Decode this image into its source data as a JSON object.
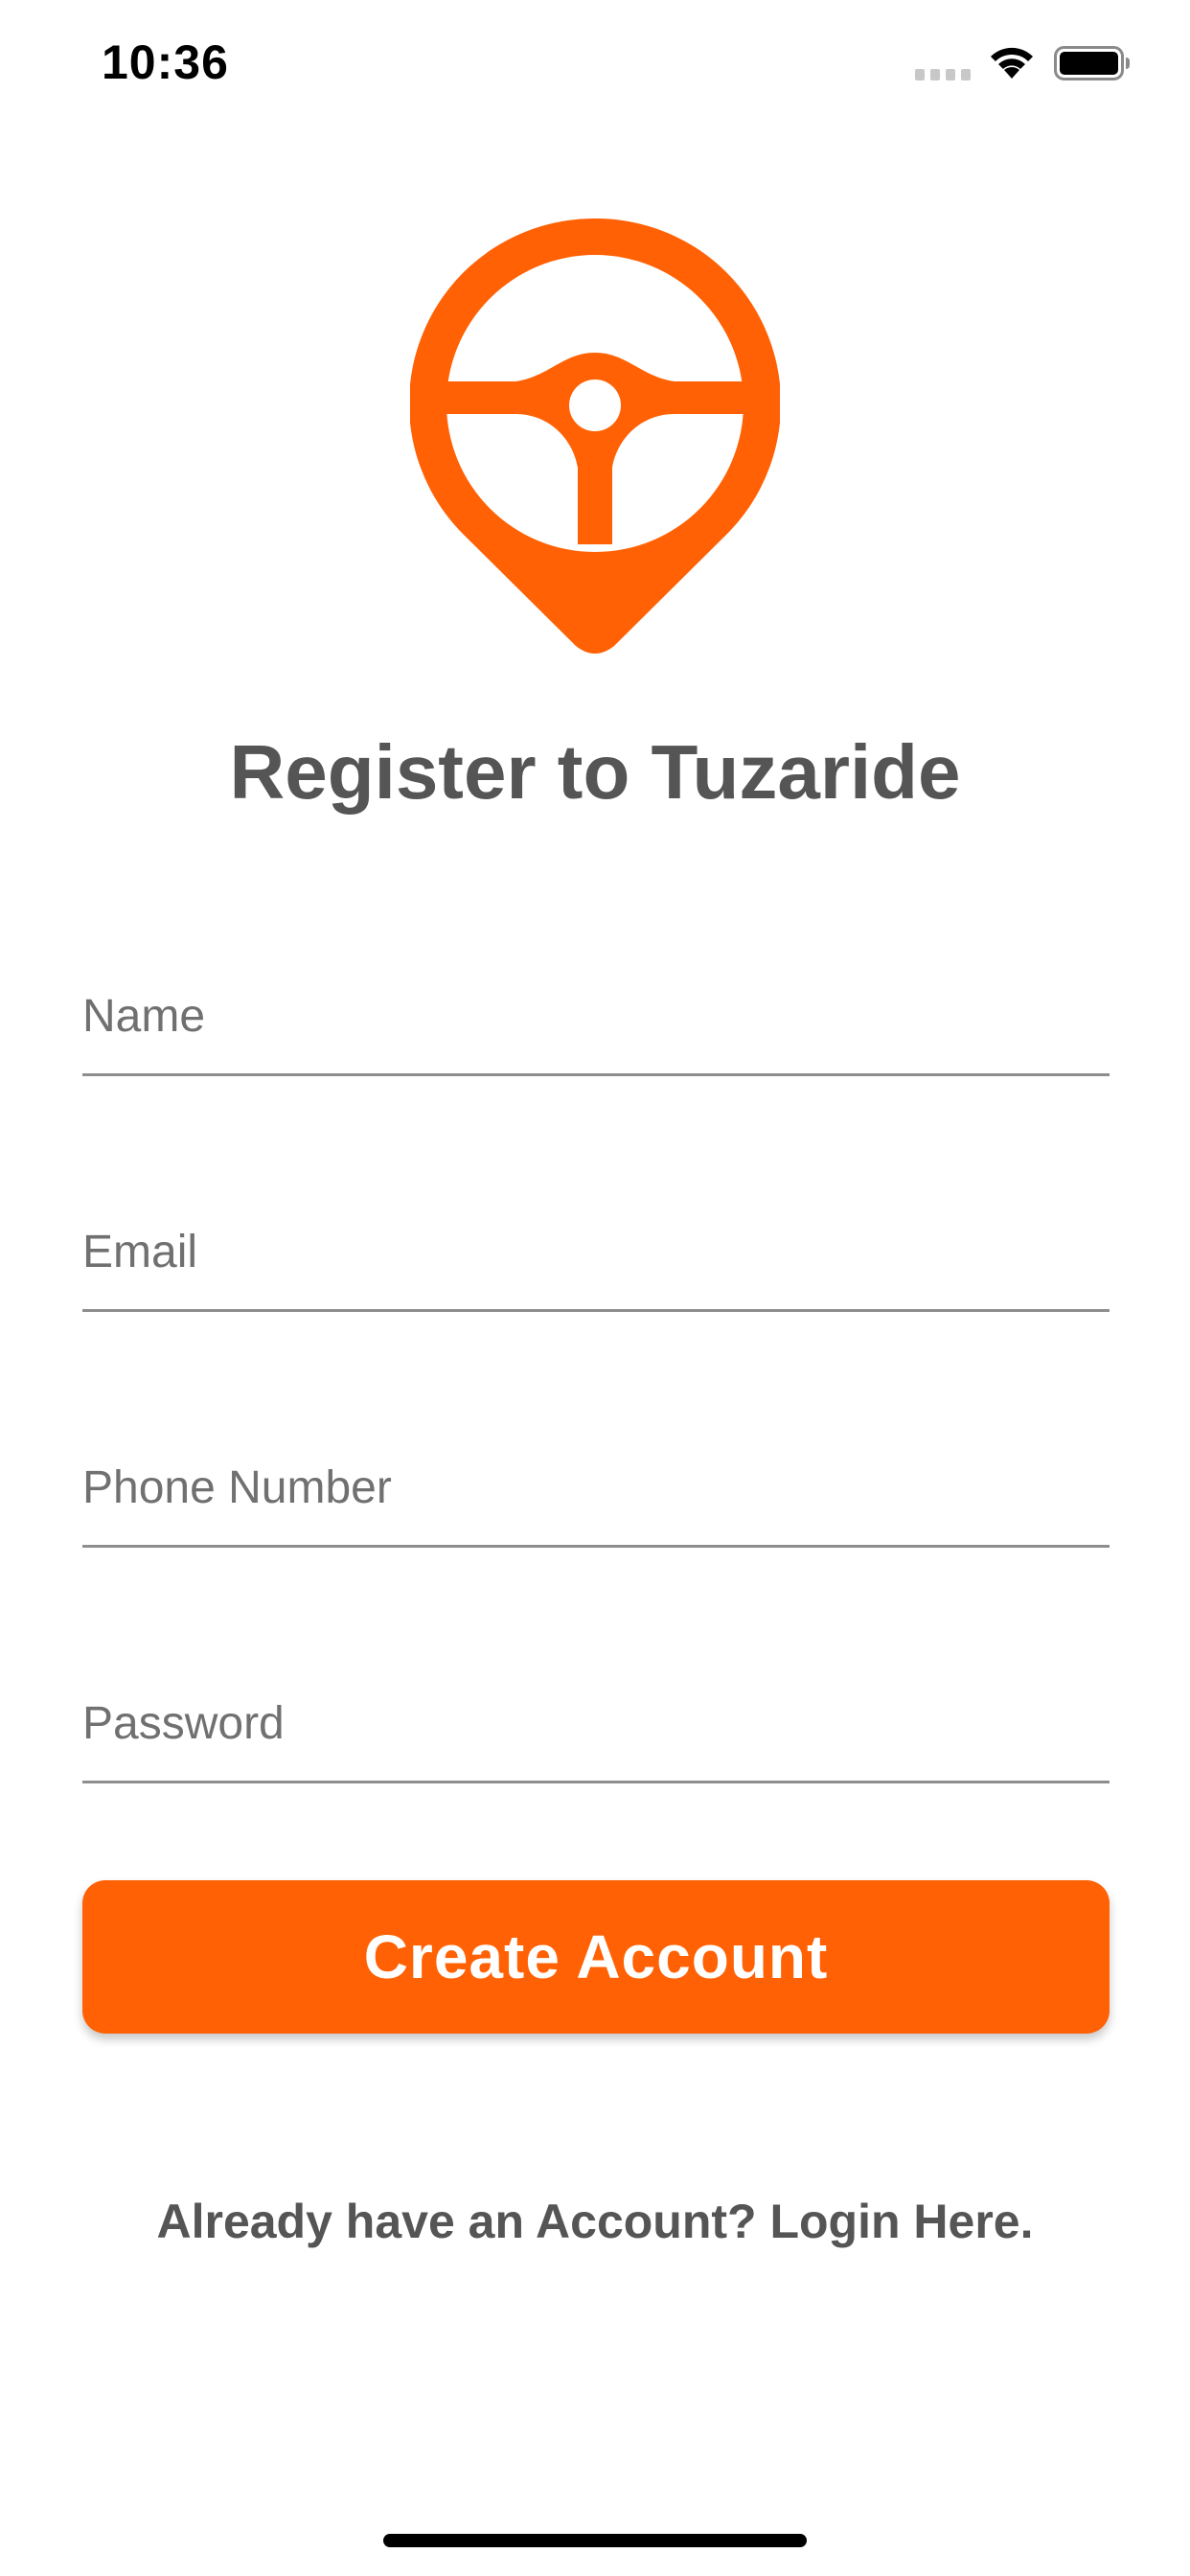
{
  "status_bar": {
    "time": "10:36",
    "icons": [
      "signal-icon",
      "wifi-icon",
      "battery-icon"
    ]
  },
  "logo": {
    "icon": "steering-wheel-pin-icon",
    "color": "#ff6104"
  },
  "title": "Register to Tuzaride",
  "form": {
    "name_placeholder": "Name",
    "email_placeholder": "Email",
    "phone_placeholder": "Phone Number",
    "password_placeholder": "Password",
    "name_value": "",
    "email_value": "",
    "phone_value": "",
    "password_value": ""
  },
  "create_button_label": "Create Account",
  "login_link": "Already have an Account? Login Here.",
  "colors": {
    "accent": "#ff6104",
    "text": "#555555",
    "placeholder": "#707070",
    "divider": "#8e8e8e"
  }
}
